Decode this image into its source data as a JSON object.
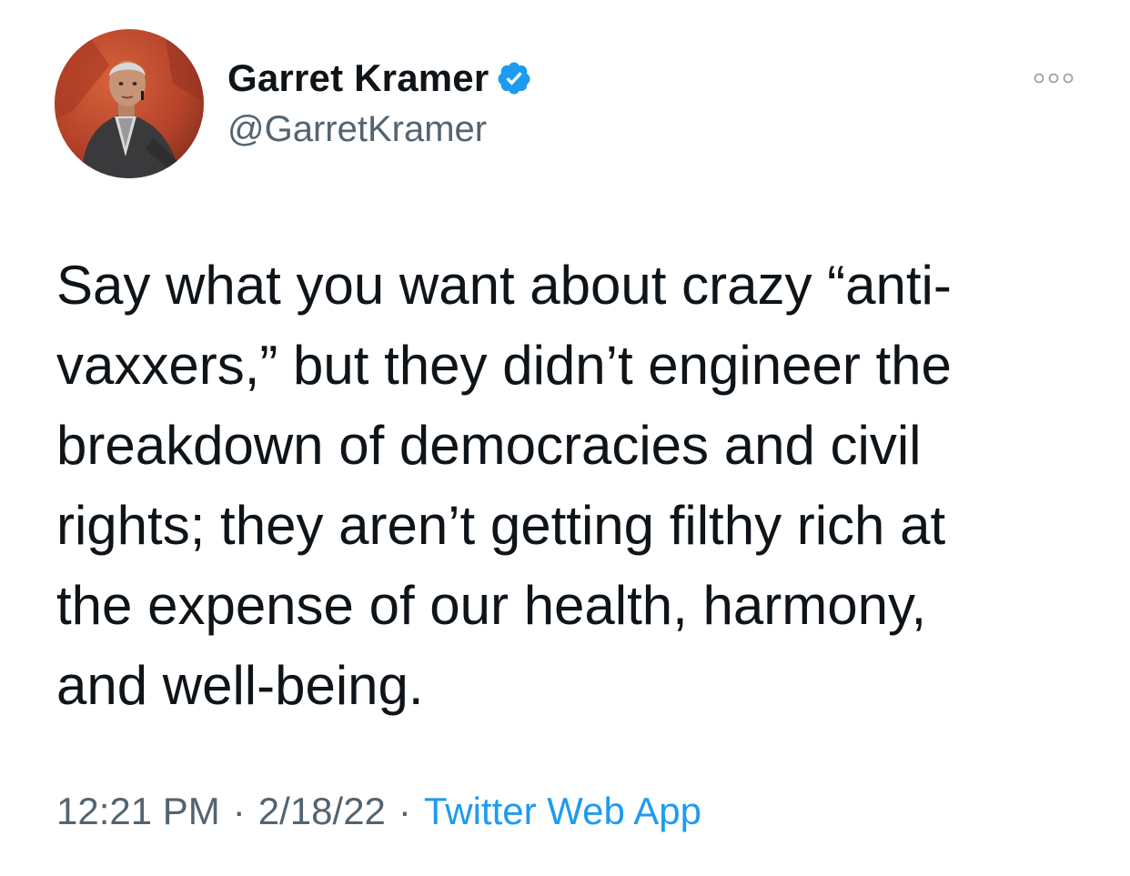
{
  "author": {
    "display_name": "Garret Kramer",
    "handle": "@GarretKramer",
    "verified_icon": "verified-badge-icon",
    "avatar_icon": "profile-photo"
  },
  "menu": {
    "icon": "more-horizontal-icon"
  },
  "tweet": {
    "text": "Say what you want about crazy “anti-\nvaxxers,” but they didn’t engineer the\nbreakdown of democracies and civil\nrights; they aren’t getting filthy rich at\nthe expense of our health, harmony,\nand well-being."
  },
  "meta": {
    "time": "12:21 PM",
    "separator": "·",
    "date": "2/18/22",
    "source": "Twitter Web App"
  },
  "colors": {
    "text_primary": "#0f1419",
    "text_secondary": "#536471",
    "accent": "#1d9bf0"
  }
}
